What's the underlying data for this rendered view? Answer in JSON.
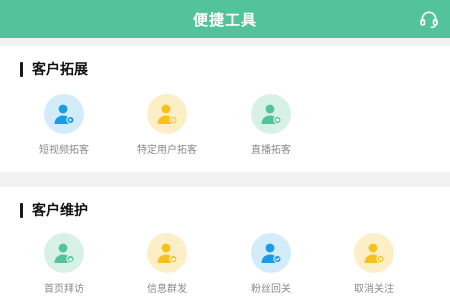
{
  "header": {
    "title": "便捷工具",
    "right_icon": "headset-icon"
  },
  "colors": {
    "header_bg": "#52c39a",
    "blue": "#1a9be8",
    "yellow": "#f6c21a",
    "green": "#52c39a"
  },
  "sections": [
    {
      "title": "客户拓展",
      "items": [
        {
          "label": "短视频拓客",
          "icon": "user-video-icon",
          "color": "blue"
        },
        {
          "label": "特定用户拓客",
          "icon": "user-target-icon",
          "color": "yellow"
        },
        {
          "label": "直播拓客",
          "icon": "user-live-icon",
          "color": "green"
        }
      ]
    },
    {
      "title": "客户维护",
      "items": [
        {
          "label": "首页拜访",
          "icon": "user-home-icon",
          "color": "green"
        },
        {
          "label": "信息群发",
          "icon": "user-message-icon",
          "color": "yellow"
        },
        {
          "label": "粉丝回关",
          "icon": "user-follow-icon",
          "color": "blue"
        },
        {
          "label": "取消关注",
          "icon": "user-unfollow-icon",
          "color": "yellow"
        }
      ]
    }
  ]
}
